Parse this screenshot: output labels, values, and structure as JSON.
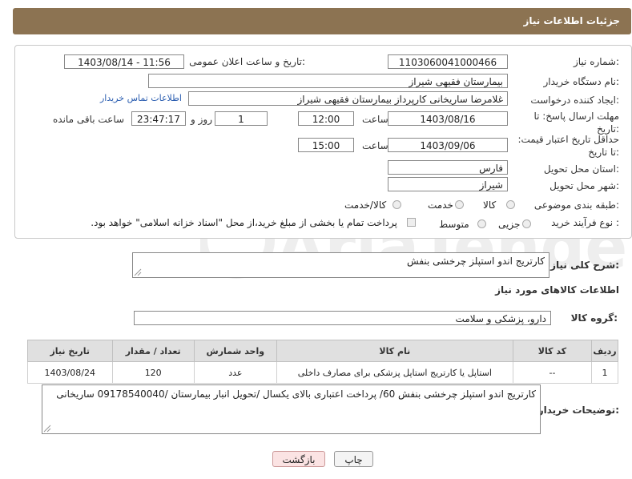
{
  "header": {
    "title": "جزئیات اطلاعات نیاز"
  },
  "form": {
    "need_number_label": "شماره نیاز:",
    "need_number": "1103060041000466",
    "announce_label": "تاریخ و ساعت اعلان عمومی:",
    "announce_value": "1403/08/14 - 11:56",
    "buyer_org_label": "نام دستگاه خریدار:",
    "buyer_org": "بیمارستان فقیهی شیراز",
    "creator_label": "ایجاد کننده درخواست:",
    "creator": "غلامرضا ساریخانی کارپرداز بیمارستان فقیهی شیراز",
    "contact_link": "اطلاعات تماس خریدار",
    "reply_deadline_label": "مهلت ارسال پاسخ: تا تاریخ:",
    "reply_date": "1403/08/16",
    "time_label": "ساعت",
    "reply_time": "12:00",
    "days_value": "1",
    "days_label": "روز و",
    "remaining_time": "23:47:17",
    "remaining_label": "ساعت باقی مانده",
    "price_validity_label": "حداقل تاریخ اعتبار قیمت: تا تاریخ:",
    "price_date": "1403/09/06",
    "price_time": "15:00",
    "province_label": "استان محل تحویل:",
    "province": "فارس",
    "city_label": "شهر محل تحویل:",
    "city": "شیراز",
    "category_label": "طبقه بندی موضوعی:",
    "category_options": [
      "کالا",
      "خدمت",
      "کالا/خدمت"
    ],
    "process_label": "نوع فرآیند خرید :",
    "process_options": [
      "جزیی",
      "متوسط"
    ],
    "payment_note": "پرداخت تمام یا بخشی از مبلغ خرید،از محل \"اسناد خزانه اسلامی\" خواهد بود."
  },
  "summary": {
    "label": "شرح کلی نیاز:",
    "value": "کارتریج اندو استپلز چرخشی بنفش"
  },
  "goods_section_title": "اطلاعات کالاهای مورد نیاز",
  "goods_group": {
    "label": "گروه کالا:",
    "value": "دارو، پزشکی و سلامت"
  },
  "table": {
    "headers": [
      "ردیف",
      "کد کالا",
      "نام کالا",
      "واحد شمارش",
      "تعداد / مقدار",
      "تاریخ نیاز"
    ],
    "rows": [
      [
        "1",
        "--",
        "استاپل یا کارتریج استاپل پزشکی برای مصارف داخلی",
        "عدد",
        "120",
        "1403/08/24"
      ]
    ]
  },
  "buyer_notes": {
    "label": "توضیحات خریدار:",
    "value": "کارتریج اندو استپلز چرخشی بنفش 60/ پرداخت اعتباری بالای یکسال /تحویل انبار بیمارستان /09178540040 ساریخانی"
  },
  "watermark": "AriaTender.net",
  "buttons": {
    "print": "چاپ",
    "back": "بازگشت"
  }
}
